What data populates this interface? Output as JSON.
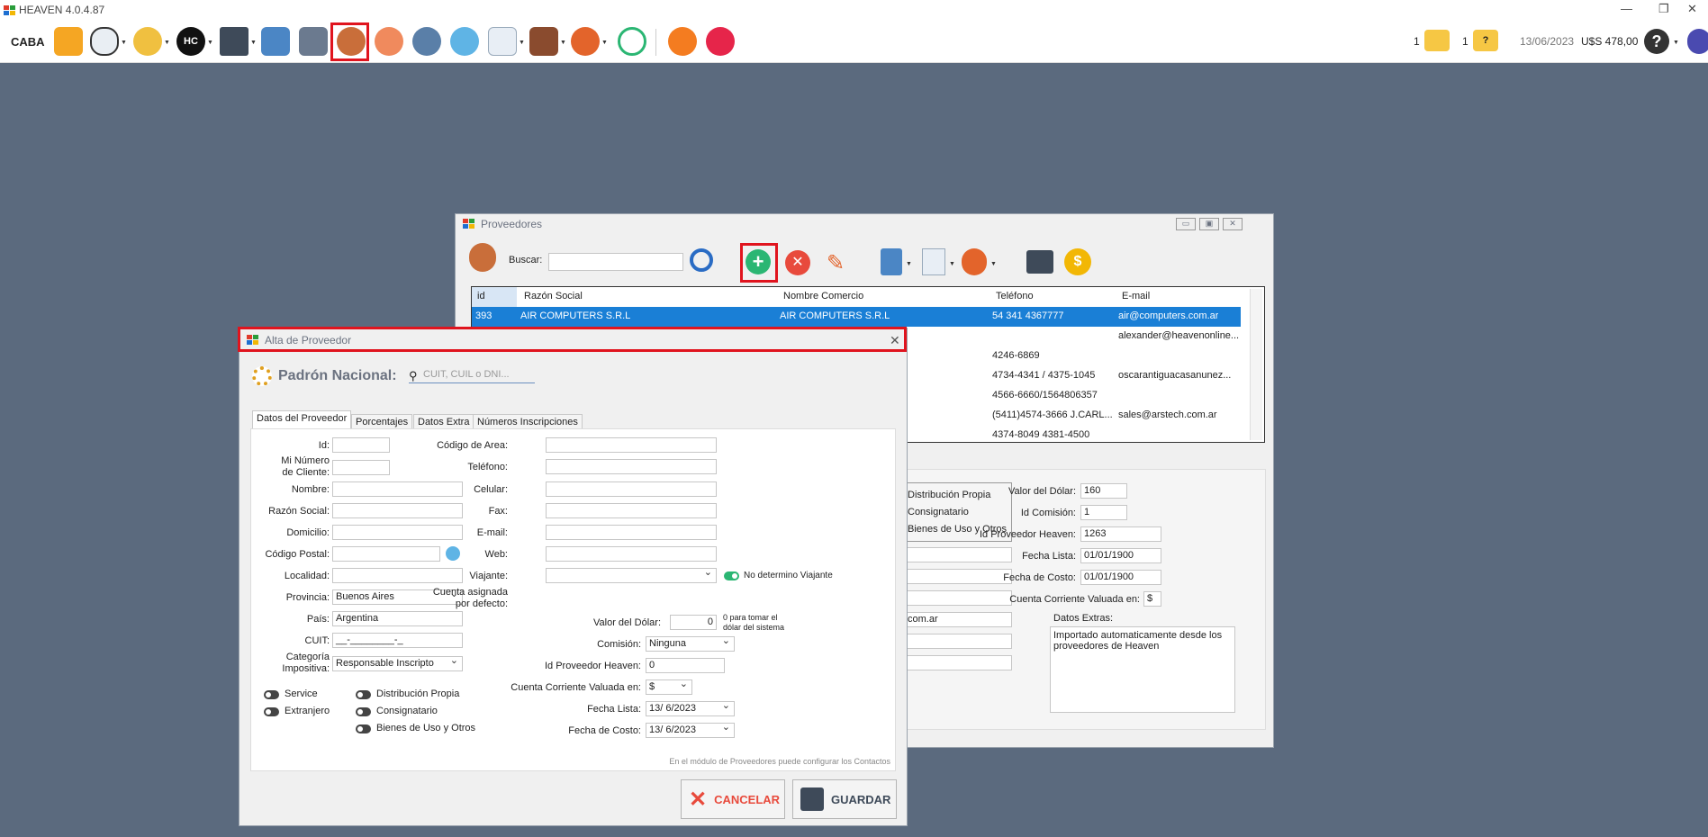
{
  "app": {
    "title": "HEAVEN 4.0.4.87",
    "location": "CABA",
    "notif_count_1": "1",
    "notif_count_2": "1",
    "date": "13/06/2023",
    "dollar": "U$S 478,00"
  },
  "colors": {
    "accent_red": "#e0141e",
    "selected_row": "#1a7fd6",
    "desktop": "#5b6a7e"
  },
  "toolbar_icons": [
    "barcode-icon",
    "printer-icon",
    "handshake-icon",
    "hc-logo-icon",
    "tools-icon",
    "calculator-icon",
    "bank-icon",
    "suppliers-icon",
    "clients-icon",
    "employee-icon",
    "globe-icon",
    "chart-icon",
    "wallet-icon",
    "settings-icon",
    "stopwatch-icon",
    "orange-app-icon",
    "red-app-icon"
  ],
  "proveedores": {
    "title": "Proveedores",
    "search_label": "Buscar:",
    "columns": [
      "id",
      "Razón Social",
      "Nombre Comercio",
      "Teléfono",
      "E-mail"
    ],
    "rows": [
      {
        "id": "393",
        "razon": "AIR COMPUTERS S.R.L",
        "nombre": "AIR COMPUTERS S.R.L",
        "tel": "54 341 4367777",
        "email": "air@computers.com.ar"
      },
      {
        "id": "",
        "razon": "",
        "nombre": "",
        "tel": "",
        "email": "alexander@heavenonline..."
      },
      {
        "id": "",
        "razon": "",
        "nombre": "",
        "tel": "4246-6869",
        "email": ""
      },
      {
        "id": "",
        "razon": "",
        "nombre": "",
        "tel": "4734-4341 / 4375-1045",
        "email": "oscarantiguacasanunez..."
      },
      {
        "id": "",
        "razon": "",
        "nombre": "",
        "tel": "4566-6660/1564806357",
        "email": ""
      },
      {
        "id": "",
        "razon": "",
        "nombre": "",
        "tel": "(5411)4574-3666 J.CARL...",
        "email": "sales@arstech.com.ar"
      },
      {
        "id": "",
        "razon": "",
        "nombre": "",
        "tel": "4374-8049  4381-4500",
        "email": ""
      }
    ],
    "detail": {
      "dist_propia": "Distribución Propia",
      "consignatario": "Consignatario",
      "bienes": "Bienes de Uso y Otros",
      "valor_dolar_label": "Valor del Dólar:",
      "valor_dolar": "160",
      "id_comision_label": "Id Comisión:",
      "id_comision": "1",
      "id_heaven_label": "Id Proveedor Heaven:",
      "id_heaven": "1263",
      "fecha_lista_label": "Fecha Lista:",
      "fecha_lista": "01/01/1900",
      "fecha_costo_label": "Fecha de Costo:",
      "fecha_costo": "01/01/1900",
      "cc_label": "Cuenta Corriente Valuada en:",
      "cc": "$",
      "extras_label": "Datos Extras:",
      "extras": "Importado automaticamente desde los proveedores de Heaven",
      "email_partial": "com.ar"
    }
  },
  "alta": {
    "title": "Alta de Proveedor",
    "padron_label": "Padrón Nacional:",
    "padron_placeholder": "CUIT, CUIL o DNI...",
    "tabs": [
      "Datos del Proveedor",
      "Porcentajes",
      "Datos Extra",
      "Números Inscripciones"
    ],
    "left": {
      "id": "Id:",
      "mi_num_1": "Mi Número",
      "mi_num_2": "de Cliente:",
      "nombre": "Nombre:",
      "razon": "Razón Social:",
      "domicilio": "Domicilio:",
      "cp": "Código Postal:",
      "localidad": "Localidad:",
      "provincia": "Provincia:",
      "provincia_val": "Buenos Aires",
      "pais": "País:",
      "pais_val": "Argentina",
      "cuit": "CUIT:",
      "cuit_val": "__-________-_",
      "categoria_1": "Categoría",
      "categoria_2": "Impositiva:",
      "categoria_val": "Responsable Inscripto"
    },
    "toggles": {
      "service": "Service",
      "extranjero": "Extranjero",
      "dist": "Distribución Propia",
      "consig": "Consignatario",
      "bienes": "Bienes de Uso y Otros"
    },
    "right": {
      "cod_area": "Código de Area:",
      "telefono": "Teléfono:",
      "celular": "Celular:",
      "fax": "Fax:",
      "email": "E-mail:",
      "web": "Web:",
      "viajante": "Viajante:",
      "no_determino": "No determino Viajante",
      "cuenta_1": "Cuenta asignada",
      "cuenta_2": "por defecto:",
      "valor_dolar": "Valor del Dólar:",
      "valor_dolar_val": "0",
      "valor_hint_1": "0 para tomar el",
      "valor_hint_2": "dólar del sistema",
      "comision": "Comisión:",
      "comision_val": "Ninguna",
      "id_heaven": "Id Proveedor Heaven:",
      "id_heaven_val": "0",
      "cc": "Cuenta Corriente Valuada en:",
      "cc_val": "$",
      "fecha_lista": "Fecha Lista:",
      "fecha_lista_val": "13/ 6/2023",
      "fecha_costo": "Fecha de Costo:",
      "fecha_costo_val": "13/ 6/2023"
    },
    "footer_note": "En el módulo de Proveedores puede configurar los Contactos",
    "cancel": "CANCELAR",
    "save": "GUARDAR"
  }
}
